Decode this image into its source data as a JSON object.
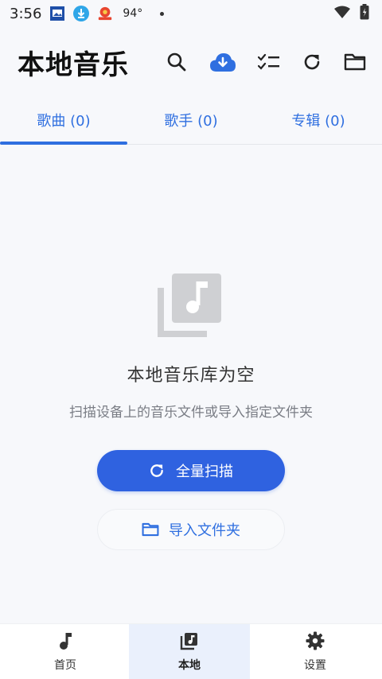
{
  "status": {
    "time": "3:56",
    "temp": "94°"
  },
  "header": {
    "title": "本地音乐"
  },
  "tabs": [
    {
      "label": "歌曲 (0)"
    },
    {
      "label": "歌手 (0)"
    },
    {
      "label": "专辑 (0)"
    }
  ],
  "empty": {
    "title": "本地音乐库为空",
    "subtitle": "扫描设备上的音乐文件或导入指定文件夹"
  },
  "actions": {
    "scan_label": "全量扫描",
    "import_label": "导入文件夹"
  },
  "bottom_nav": [
    {
      "label": "首页",
      "icon": "music-note-icon"
    },
    {
      "label": "本地",
      "icon": "library-music-icon"
    },
    {
      "label": "设置",
      "icon": "gear-icon"
    }
  ],
  "colors": {
    "accent": "#2f62e0",
    "tab_text": "#2f6fe0",
    "cloud": "#2f6fe0"
  }
}
